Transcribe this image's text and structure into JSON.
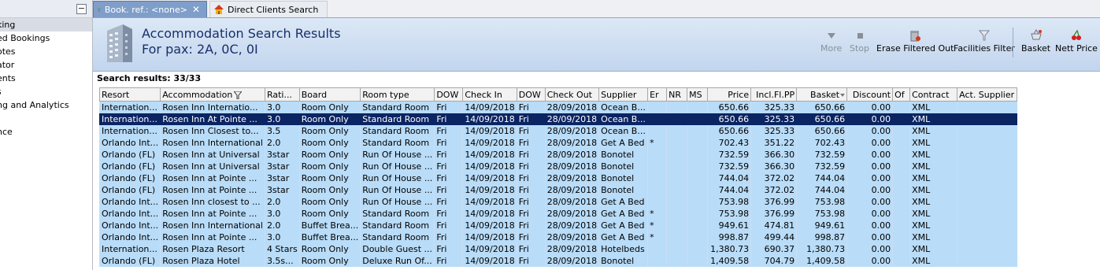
{
  "sidebar": {
    "items": [
      {
        "label": "king",
        "selected": true
      },
      {
        "label": "ed Bookings"
      },
      {
        "label": "otes"
      },
      {
        "label": "ator"
      },
      {
        "label": "ents"
      },
      {
        "label": "s"
      },
      {
        "label": "ng and Analytics"
      },
      {
        "label": ""
      },
      {
        "label": "nce"
      }
    ],
    "collapse_symbol": "−"
  },
  "tabs": [
    {
      "label": "Book. ref.: <none>",
      "icon": "palm-tree-icon",
      "active": true
    },
    {
      "label": "Direct Clients Search",
      "icon": "house-icon",
      "active": false
    }
  ],
  "header": {
    "title": "Accommodation Search Results",
    "subtitle": "For pax: 2A, 0C, 0I"
  },
  "toolbar": {
    "more": "More",
    "stop": "Stop",
    "erase_filtered_out": "Erase Filtered Out",
    "facilities_filter": "Facilities Filter",
    "basket": "Basket",
    "nett_price": "Nett Price"
  },
  "results": {
    "label": "Search results: 33/33"
  },
  "table": {
    "columns": [
      "Resort",
      "Accommodation",
      "Rati...",
      "Board",
      "Room type",
      "DOW",
      "Check In",
      "DOW",
      "Check Out",
      "Supplier",
      "Er",
      "NR",
      "MS",
      "Price",
      "Incl.Fl.PP",
      "Basket",
      "Discount",
      "Of",
      "Contract",
      "Act. Supplier"
    ],
    "rows": [
      [
        "Internation...",
        "Rosen Inn Internatio...",
        "3.0",
        "Room Only",
        "Standard Room",
        "Fri",
        "14/09/2018",
        "Fri",
        "28/09/2018",
        "Ocean B...",
        "",
        "",
        "",
        "650.66",
        "325.33",
        "650.66",
        "0.00",
        "",
        "XML",
        ""
      ],
      [
        "Internation...",
        "Rosen Inn At Pointe ...",
        "3.0",
        "Room Only",
        "Standard Room",
        "Fri",
        "14/09/2018",
        "Fri",
        "28/09/2018",
        "Ocean B...",
        "",
        "",
        "",
        "650.66",
        "325.33",
        "650.66",
        "0.00",
        "",
        "XML",
        ""
      ],
      [
        "Internation...",
        "Rosen Inn Closest to...",
        "3.5",
        "Room Only",
        "Standard Room",
        "Fri",
        "14/09/2018",
        "Fri",
        "28/09/2018",
        "Ocean B...",
        "",
        "",
        "",
        "650.66",
        "325.33",
        "650.66",
        "0.00",
        "",
        "XML",
        ""
      ],
      [
        "Orlando Int...",
        "Rosen Inn International",
        "2.0",
        "Room Only",
        "Standard Room",
        "Fri",
        "14/09/2018",
        "Fri",
        "28/09/2018",
        "Get A Bed",
        "*",
        "",
        "",
        "702.43",
        "351.22",
        "702.43",
        "0.00",
        "",
        "XML",
        ""
      ],
      [
        "Orlando (FL)",
        "Rosen Inn at Universal",
        "3star",
        "Room Only",
        "Run Of House ...",
        "Fri",
        "14/09/2018",
        "Fri",
        "28/09/2018",
        "Bonotel",
        "",
        "",
        "",
        "732.59",
        "366.30",
        "732.59",
        "0.00",
        "",
        "XML",
        ""
      ],
      [
        "Orlando (FL)",
        "Rosen Inn at Universal",
        "3star",
        "Room Only",
        "Run Of House ...",
        "Fri",
        "14/09/2018",
        "Fri",
        "28/09/2018",
        "Bonotel",
        "",
        "",
        "",
        "732.59",
        "366.30",
        "732.59",
        "0.00",
        "",
        "XML",
        ""
      ],
      [
        "Orlando (FL)",
        "Rosen Inn at Pointe ...",
        "3star",
        "Room Only",
        "Run Of House ...",
        "Fri",
        "14/09/2018",
        "Fri",
        "28/09/2018",
        "Bonotel",
        "",
        "",
        "",
        "744.04",
        "372.02",
        "744.04",
        "0.00",
        "",
        "XML",
        ""
      ],
      [
        "Orlando (FL)",
        "Rosen Inn at Pointe ...",
        "3star",
        "Room Only",
        "Run Of House ...",
        "Fri",
        "14/09/2018",
        "Fri",
        "28/09/2018",
        "Bonotel",
        "",
        "",
        "",
        "744.04",
        "372.02",
        "744.04",
        "0.00",
        "",
        "XML",
        ""
      ],
      [
        "Orlando Int...",
        "Rosen Inn closest to ...",
        "2.0",
        "Room Only",
        "Run Of House ...",
        "Fri",
        "14/09/2018",
        "Fri",
        "28/09/2018",
        "Get A Bed",
        "",
        "",
        "",
        "753.98",
        "376.99",
        "753.98",
        "0.00",
        "",
        "XML",
        ""
      ],
      [
        "Orlando Int...",
        "Rosen Inn at Pointe ...",
        "3.0",
        "Room Only",
        "Standard Room",
        "Fri",
        "14/09/2018",
        "Fri",
        "28/09/2018",
        "Get A Bed",
        "*",
        "",
        "",
        "753.98",
        "376.99",
        "753.98",
        "0.00",
        "",
        "XML",
        ""
      ],
      [
        "Orlando Int...",
        "Rosen Inn International",
        "2.0",
        "Buffet Brea...",
        "Standard Room",
        "Fri",
        "14/09/2018",
        "Fri",
        "28/09/2018",
        "Get A Bed",
        "*",
        "",
        "",
        "949.61",
        "474.81",
        "949.61",
        "0.00",
        "",
        "XML",
        ""
      ],
      [
        "Orlando Int...",
        "Rosen Inn at Pointe ...",
        "3.0",
        "Buffet Brea...",
        "Standard Room",
        "Fri",
        "14/09/2018",
        "Fri",
        "28/09/2018",
        "Get A Bed",
        "*",
        "",
        "",
        "998.87",
        "499.44",
        "998.87",
        "0.00",
        "",
        "XML",
        ""
      ],
      [
        "Internation...",
        "Rosen Plaza Resort",
        "4 Stars",
        "Room Only",
        "Double Guest ...",
        "Fri",
        "14/09/2018",
        "Fri",
        "28/09/2018",
        "Hotelbeds",
        "",
        "",
        "",
        "1,380.73",
        "690.37",
        "1,380.73",
        "0.00",
        "",
        "XML",
        ""
      ],
      [
        "Orlando (FL)",
        "Rosen Plaza Hotel",
        "3.5s...",
        "Room Only",
        "Deluxe Run Of...",
        "Fri",
        "14/09/2018",
        "Fri",
        "28/09/2018",
        "Bonotel",
        "",
        "",
        "",
        "1,409.58",
        "704.79",
        "1,409.58",
        "0.00",
        "",
        "XML",
        ""
      ]
    ],
    "selected_row": 1
  },
  "colors": {
    "header_title": "#16306a",
    "row_bg": "#b9dcf8",
    "selected_row_bg": "#0b2462",
    "active_tab": "#7f9ec9"
  }
}
